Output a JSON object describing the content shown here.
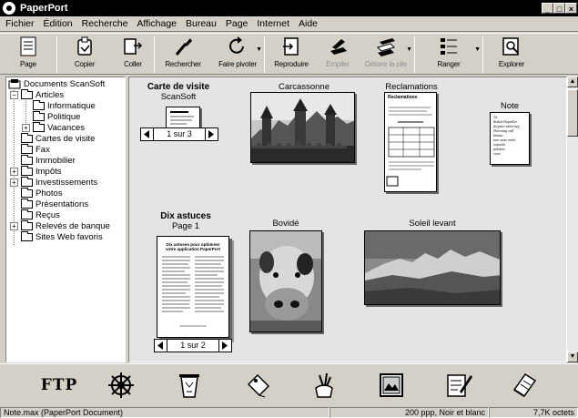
{
  "window": {
    "title": "PaperPort",
    "minimize": "_",
    "maximize": "□",
    "close": "×"
  },
  "menu": [
    "Fichier",
    "Édition",
    "Recherche",
    "Affichage",
    "Bureau",
    "Page",
    "Internet",
    "Aide"
  ],
  "toolbar": {
    "page": "Page",
    "copier": "Copier",
    "coller": "Coller",
    "rechercher": "Rechercher",
    "faire_pivoter": "Faire pivoter",
    "reproduire": "Reproduire",
    "empiler": "Empiler",
    "detacher": "Détaire la pile",
    "ranger": "Ranger",
    "explorer": "Explorer"
  },
  "tree": {
    "root": "Documents ScanSoft",
    "items": [
      "Articles",
      "Informatique",
      "Politique",
      "Vacances",
      "Cartes de visite",
      "Fax",
      "Immobilier",
      "Impôts",
      "Investissements",
      "Photos",
      "Présentations",
      "Reçus",
      "Relevés de banque",
      "Sites Web favoris"
    ]
  },
  "desktop": {
    "carte_title": "Carte de visite",
    "carte_sub": "ScanSoft",
    "carte_page": "1 sur 3",
    "carcassonne": "Carcassonne",
    "reclamations": "Reclamations",
    "note": "Note",
    "astuces_title": "Dix astuces",
    "astuces_sub": "Page 1",
    "astuces_page": "1 sur 2",
    "astuces_heading": "Dix astuces pour optimiser votre application PaperPort",
    "bovide": "Bovidé",
    "soleil": "Soleil levant",
    "reclam_heading": "Reclamations",
    "note_lines": [
      "To:",
      "Bobet Hopeller",
      "Keyster attorney",
      "Planning call",
      "Ibisau",
      "non seas onde",
      "sopsela",
      "pelobio",
      "cove"
    ]
  },
  "launch_icons": [
    "ftp-icon",
    "compass-icon",
    "recycle-icon",
    "tag-icon",
    "paint-brush-icon",
    "image-editor-icon",
    "notepad-icon",
    "note-pad-icon"
  ],
  "launch_ftp_label": "FTP",
  "status": {
    "file": "Note.max (PaperPort Document)",
    "resolution": "200 ppp, Noir et blanc",
    "size": "7,7K octets"
  }
}
